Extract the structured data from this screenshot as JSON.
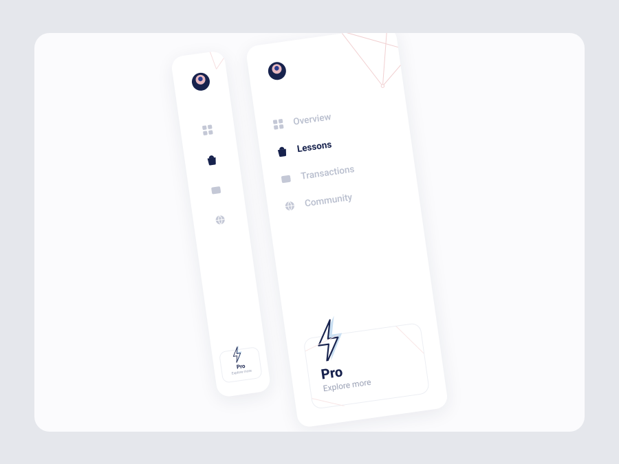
{
  "colors": {
    "brand_dark": "#17224d",
    "brand_accent": "#e7b8c0",
    "muted_text": "#b7bdcd",
    "panel_bg": "#ffffff",
    "page_bg": "#e5e7ec",
    "canvas_bg": "#fbfbfd",
    "bolt_light": "#c9dff2"
  },
  "nav": {
    "items": [
      {
        "label": "Overview",
        "icon": "grid-icon",
        "active": false
      },
      {
        "label": "Lessons",
        "icon": "bag-icon",
        "active": true
      },
      {
        "label": "Transactions",
        "icon": "wallet-icon",
        "active": false
      },
      {
        "label": "Community",
        "icon": "globe-icon",
        "active": false
      }
    ]
  },
  "promo": {
    "title": "Pro",
    "subtitle": "Explore more"
  }
}
